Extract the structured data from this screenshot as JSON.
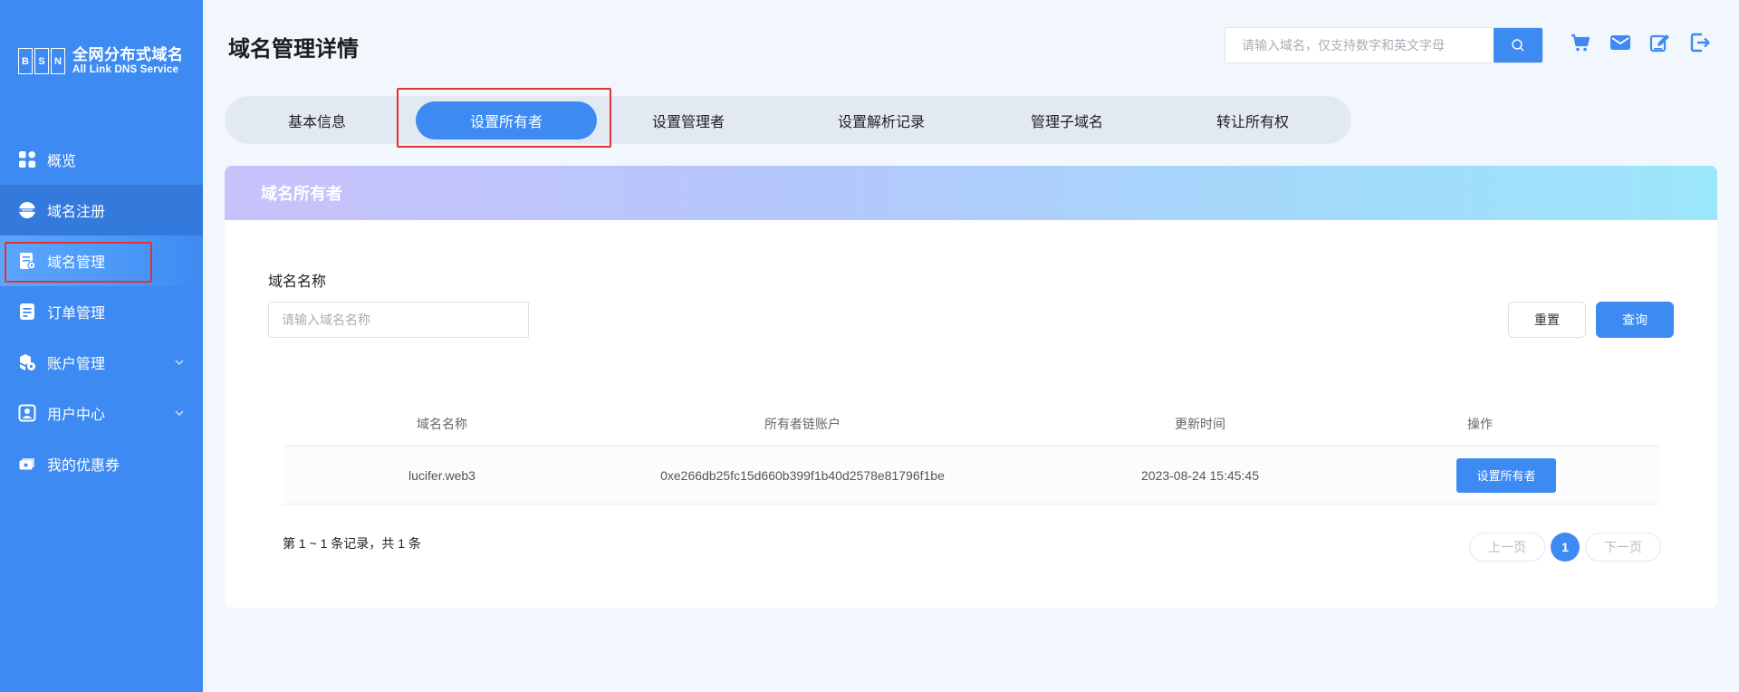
{
  "brand": {
    "letters": [
      "B",
      "S",
      "N"
    ],
    "name_cn": "全网分布式域名",
    "name_en": "All Link DNS Service"
  },
  "sidebar": {
    "items": [
      {
        "label": "概览",
        "icon": "grid-icon"
      },
      {
        "label": "域名注册",
        "icon": "www-icon"
      },
      {
        "label": "域名管理",
        "icon": "domain-manage-icon"
      },
      {
        "label": "订单管理",
        "icon": "order-icon"
      },
      {
        "label": "账户管理",
        "icon": "account-icon",
        "has_submenu": true
      },
      {
        "label": "用户中心",
        "icon": "user-icon",
        "has_submenu": true
      },
      {
        "label": "我的优惠券",
        "icon": "coupon-icon"
      }
    ]
  },
  "header": {
    "title": "域名管理详情",
    "search_placeholder": "请输入域名，仅支持数字和英文字母",
    "icons": [
      "cart-icon",
      "mail-icon",
      "edit-icon",
      "logout-icon"
    ]
  },
  "tabs": [
    {
      "label": "基本信息"
    },
    {
      "label": "设置所有者"
    },
    {
      "label": "设置管理者"
    },
    {
      "label": "设置解析记录"
    },
    {
      "label": "管理子域名"
    },
    {
      "label": "转让所有权"
    }
  ],
  "card": {
    "title": "域名所有者",
    "field_label": "域名名称",
    "field_placeholder": "请输入域名名称",
    "reset_label": "重置",
    "query_label": "查询"
  },
  "table": {
    "columns": [
      "域名名称",
      "所有者链账户",
      "更新时间",
      "操作"
    ],
    "rows": [
      {
        "domain": "lucifer.web3",
        "owner": "0xe266db25fc15d660b399f1b40d2578e81796f1be",
        "updated": "2023-08-24 15:45:45",
        "action": "设置所有者"
      }
    ]
  },
  "pagination": {
    "info": "第 1 ~ 1 条记录，共 1 条",
    "prev": "上一页",
    "current": "1",
    "next": "下一页"
  },
  "colors": {
    "primary": "#3d8bf2",
    "highlight_border": "#e6322e"
  }
}
